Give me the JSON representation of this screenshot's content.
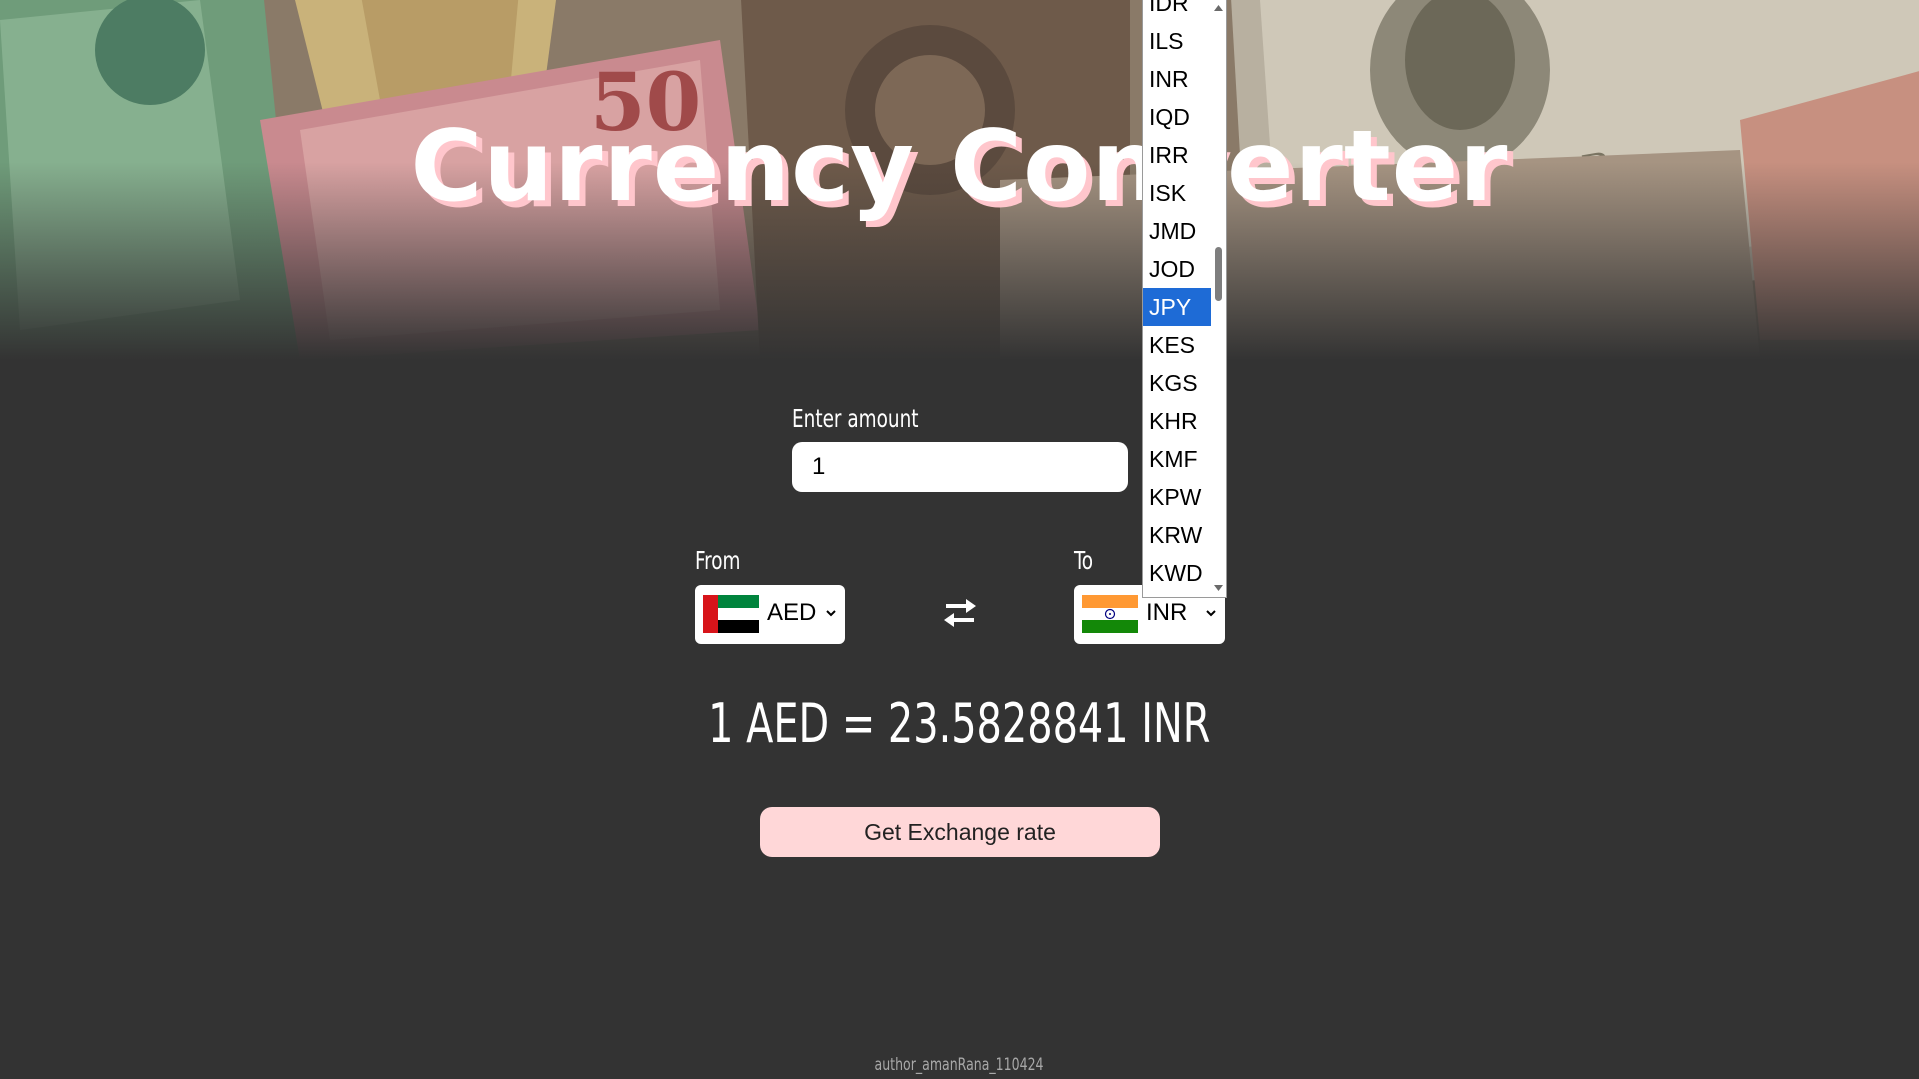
{
  "title": "Currency Converter",
  "amount": {
    "label": "Enter amount",
    "value": "1"
  },
  "from": {
    "label": "From",
    "currency": "AED",
    "flag": "uae-flag-icon"
  },
  "to": {
    "label": "To",
    "currency": "INR",
    "flag": "india-flag-icon"
  },
  "swap_icon": "swap-arrows-icon",
  "result": "1 AED = 23.5828841 INR",
  "button": {
    "label": "Get Exchange rate"
  },
  "author": "author_amanRana_110424",
  "dropdown": {
    "options": [
      "IDR",
      "ILS",
      "INR",
      "IQD",
      "IRR",
      "ISK",
      "JMD",
      "JOD",
      "JPY",
      "KES",
      "KGS",
      "KHR",
      "KMF",
      "KPW",
      "KRW",
      "KWD"
    ],
    "highlighted": "JPY"
  },
  "colors": {
    "background": "#333333",
    "title_shadow": "#ffc6cc",
    "button_bg": "#ffd7d8",
    "highlight": "#1e6bd6"
  }
}
